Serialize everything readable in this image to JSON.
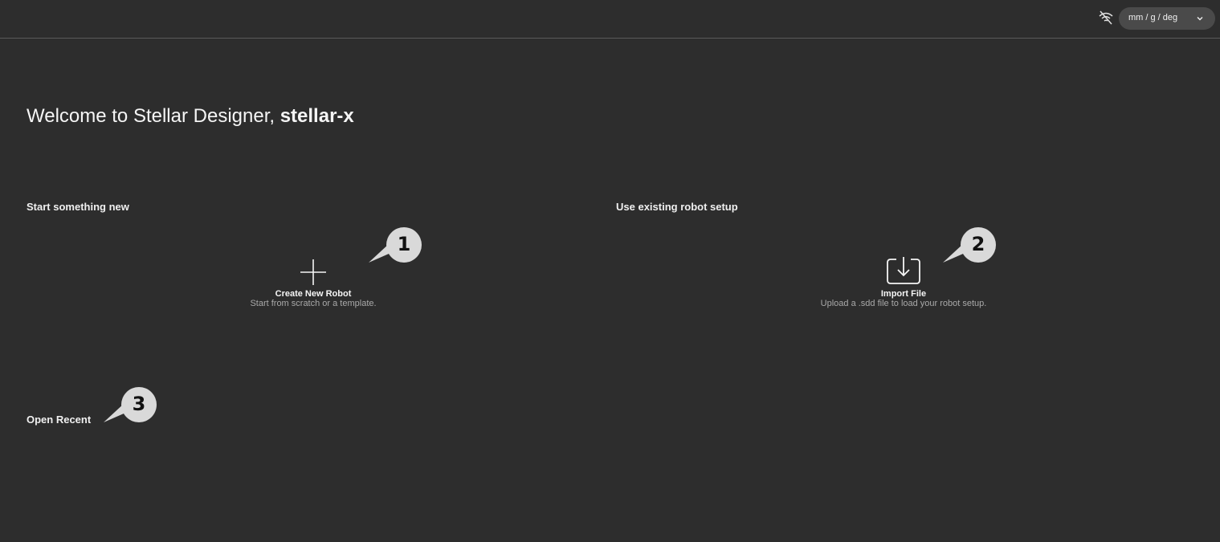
{
  "header": {
    "units_value": "mm / g / deg",
    "offline_icon": "wifi-off-icon",
    "dropdown_icon": "chevron-down-icon"
  },
  "welcome": {
    "prefix": "Welcome to Stellar Designer, ",
    "username": "stellar-x"
  },
  "sections": {
    "new_heading": "Start something new",
    "existing_heading": "Use existing robot setup",
    "recent_heading": "Open Recent"
  },
  "actions": {
    "create": {
      "icon": "plus-icon",
      "title": "Create New Robot",
      "description": "Start from scratch or a template."
    },
    "import": {
      "icon": "import-icon",
      "title": "Import File",
      "description": "Upload a .sdd file to load your robot setup."
    }
  },
  "callouts": [
    "1",
    "2",
    "3"
  ],
  "colors": {
    "background": "#2d2d2d",
    "callout_fill": "#d9d9d9",
    "divider": "#5a5a5a"
  }
}
